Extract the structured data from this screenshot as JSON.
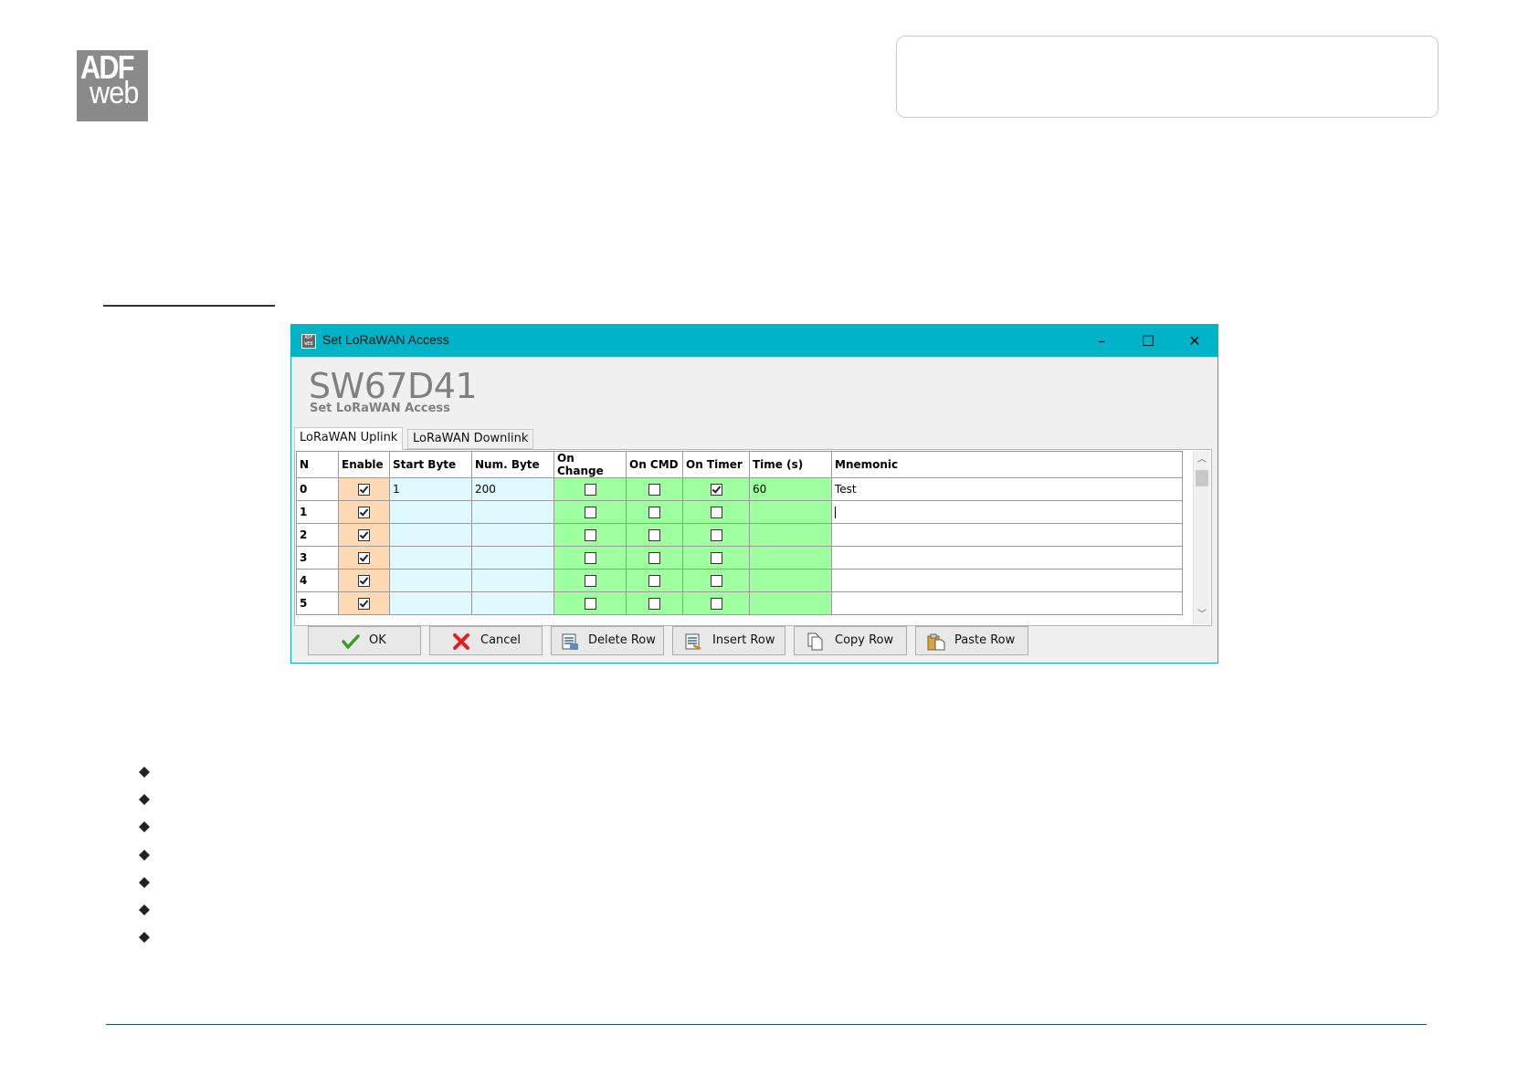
{
  "header": {
    "logo_top": "ADF",
    "logo_bottom": "web"
  },
  "window": {
    "title": "Set LoRaWAN Access",
    "app_icon_text": "ADF WEB",
    "controls": {
      "minimize": "–",
      "maximize": "☐",
      "close": "✕"
    },
    "product_title": "SW67D41",
    "product_subtitle": "Set LoRaWAN Access",
    "tabs": [
      {
        "label": "LoRaWAN Uplink",
        "active": true
      },
      {
        "label": "LoRaWAN Downlink",
        "active": false
      }
    ]
  },
  "grid": {
    "columns": [
      "N",
      "Enable",
      "Start Byte",
      "Num. Byte",
      "On Change",
      "On CMD",
      "On Timer",
      "Time (s)",
      "Mnemonic"
    ],
    "rows": [
      {
        "n": "0",
        "enable": true,
        "start_byte": "1",
        "num_byte": "200",
        "on_change": false,
        "on_cmd": false,
        "on_timer": true,
        "time": "60",
        "mnemonic": "Test"
      },
      {
        "n": "1",
        "enable": true,
        "start_byte": "",
        "num_byte": "",
        "on_change": false,
        "on_cmd": false,
        "on_timer": false,
        "time": "",
        "mnemonic": ""
      },
      {
        "n": "2",
        "enable": true,
        "start_byte": "",
        "num_byte": "",
        "on_change": false,
        "on_cmd": false,
        "on_timer": false,
        "time": "",
        "mnemonic": ""
      },
      {
        "n": "3",
        "enable": true,
        "start_byte": "",
        "num_byte": "",
        "on_change": false,
        "on_cmd": false,
        "on_timer": false,
        "time": "",
        "mnemonic": ""
      },
      {
        "n": "4",
        "enable": true,
        "start_byte": "",
        "num_byte": "",
        "on_change": false,
        "on_cmd": false,
        "on_timer": false,
        "time": "",
        "mnemonic": ""
      },
      {
        "n": "5",
        "enable": true,
        "start_byte": "",
        "num_byte": "",
        "on_change": false,
        "on_cmd": false,
        "on_timer": false,
        "time": "",
        "mnemonic": ""
      }
    ]
  },
  "buttons": {
    "ok": "OK",
    "cancel": "Cancel",
    "delete_row": "Delete Row",
    "insert_row": "Insert Row",
    "copy_row": "Copy Row",
    "paste_row": "Paste Row"
  },
  "colors": {
    "titlebar": "#00b4c8",
    "enable_column": "#ffd9b3",
    "byte_columns": "#e0f8ff",
    "trigger_columns": "#9eff9e"
  }
}
